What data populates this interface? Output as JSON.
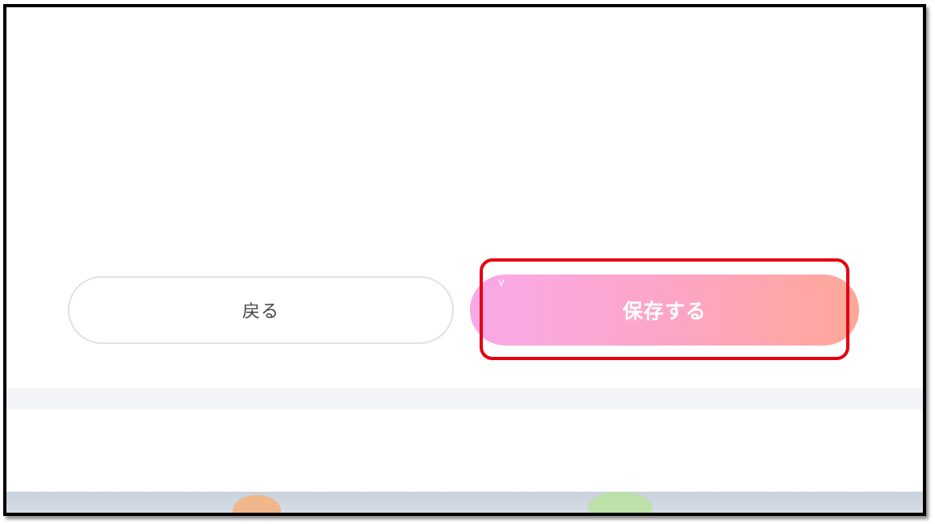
{
  "buttons": {
    "back_label": "戻る",
    "save_label": "保存する"
  },
  "cursor_mark": "v",
  "colors": {
    "save_gradient_start": "#f9a9e8",
    "save_gradient_end": "#ffa898",
    "highlight": "#e50012",
    "divider": "#f2f4f7"
  }
}
